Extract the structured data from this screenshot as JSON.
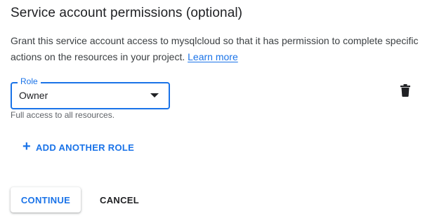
{
  "section": {
    "title": "Service account permissions (optional)",
    "description": "Grant this service account access to mysqlcloud so that it has permission to complete specific actions on the resources in your project.",
    "learn_more": "Learn more"
  },
  "role_field": {
    "label": "Role",
    "value": "Owner",
    "hint": "Full access to all resources."
  },
  "icons": {
    "delete": "trash-icon",
    "dropdown": "dropdown-arrow-icon",
    "add": "plus-icon"
  },
  "actions": {
    "add_role": "ADD ANOTHER ROLE",
    "continue": "CONTINUE",
    "cancel": "CANCEL"
  },
  "colors": {
    "accent": "#1a73e8",
    "text": "#202124",
    "secondary_text": "#5f6368"
  }
}
